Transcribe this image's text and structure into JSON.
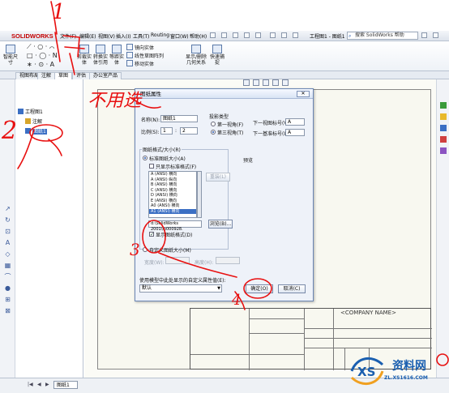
{
  "app": {
    "logo": "SOLIDWORKS",
    "doc_title": "工程图1 - 图纸1",
    "search_placeholder": "搜索 SolidWorks 帮助"
  },
  "menu": [
    "文件(F)",
    "编辑(E)",
    "视图(V)",
    "插入(I)",
    "工具(T)",
    "Routing",
    "窗口(W)",
    "帮助(H)"
  ],
  "ribbon": {
    "big_buttons": [
      "智能尺寸",
      "剪裁实体",
      "转换实体引用",
      "等距实体",
      "显示/删除几何关系",
      "快速捕捉"
    ],
    "small_buttons": [
      "镜向实体",
      "线性草图阵列",
      "移动实体"
    ]
  },
  "tabs": [
    "视图布局",
    "注解",
    "草图",
    "评估",
    "办公室产品"
  ],
  "feature_tree": {
    "root": "工程图1",
    "notes": "注解",
    "sheet": "图纸1"
  },
  "dialog": {
    "title": "图纸属性",
    "name_label": "名称(N):",
    "name_value": "图纸1",
    "scale_label": "比例(S):",
    "scale_a": "1",
    "scale_sep": ":",
    "scale_b": "2",
    "projection_label": "投影类型",
    "first_angle": "第一视角(F)",
    "third_angle": "第三视角(T)",
    "next_view_label": "下一视图标号(V):",
    "next_view_value": "A",
    "next_datum_label": "下一基准标号(U):",
    "next_datum_value": "A",
    "format_group": "图纸格式/大小(R)",
    "standard_size": "标准图纸大小(A)",
    "only_standard": "只显示标准格式(F)",
    "sizes": [
      "A (ANSI) 横向",
      "A (ANSI) 纵向",
      "B (ANSI) 横向",
      "C (ANSI) 横向",
      "D (ANSI) 横向",
      "E (ANSI) 横向",
      "A0 (ANSI) 横向",
      "A1 (ANSI) 横向"
    ],
    "reload_button": "重装(L)",
    "preview_label": "预览",
    "format_path": "d:\\SolidWorks 2001\\lp000928.",
    "browse_button": "浏览(B)...",
    "show_format": "显示图纸格式(D)",
    "custom_size": "自定义图纸大小(M)",
    "width_label": "宽度(W):",
    "height_label": "高度(H):",
    "custom_props_label": "使用模型中此处显示的自定义属性值(E):",
    "custom_props_value": "默认",
    "ok_button": "确定(O)",
    "cancel_button": "取消(C)"
  },
  "titleblock": {
    "company": "<COMPANY NAME>"
  },
  "status": {
    "sheet_tab": "图纸1"
  },
  "annotations": {
    "n1": "1",
    "n2": "2",
    "n3": "3",
    "n4": "4",
    "word": "不用选"
  },
  "watermark": {
    "text": "资料网",
    "url": "ZL.XS1616.COM"
  },
  "colors": {
    "annotation": "#e81010",
    "selection": "#3b6fc4",
    "watermark": "#1a5fb0"
  }
}
